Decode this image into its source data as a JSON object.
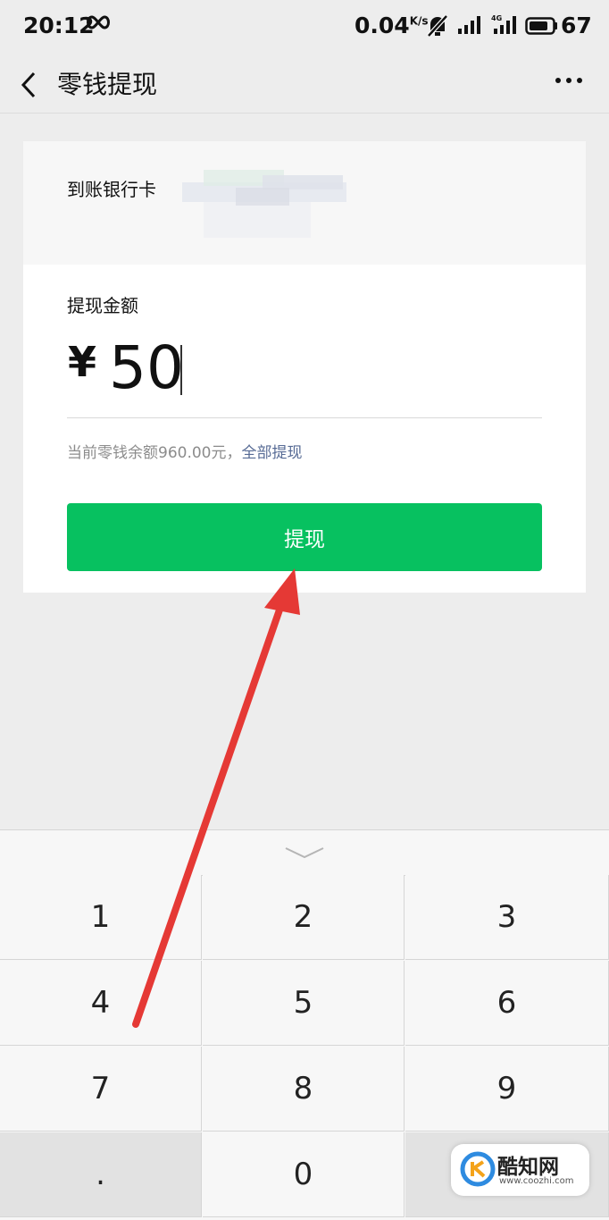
{
  "status_bar": {
    "time": "20:12",
    "net_speed": "0.04",
    "net_speed_unit": "K/s",
    "battery": "67"
  },
  "nav": {
    "title": "零钱提现"
  },
  "card": {
    "bank_label": "到账银行卡",
    "amount_label": "提现金额",
    "currency": "¥",
    "amount": "50",
    "balance_text": "当前零钱余额960.00元，",
    "withdraw_all": "全部提现",
    "withdraw_button": "提现"
  },
  "keypad": {
    "keys": [
      "1",
      "2",
      "3",
      "4",
      "5",
      "6",
      "7",
      "8",
      "9",
      ".",
      "0",
      ""
    ]
  },
  "watermark": {
    "name": "酷知网",
    "url": "www.coozhi.com"
  },
  "colors": {
    "primary_green": "#07c160",
    "link_blue": "#576b95",
    "arrow_red": "#e53935"
  }
}
